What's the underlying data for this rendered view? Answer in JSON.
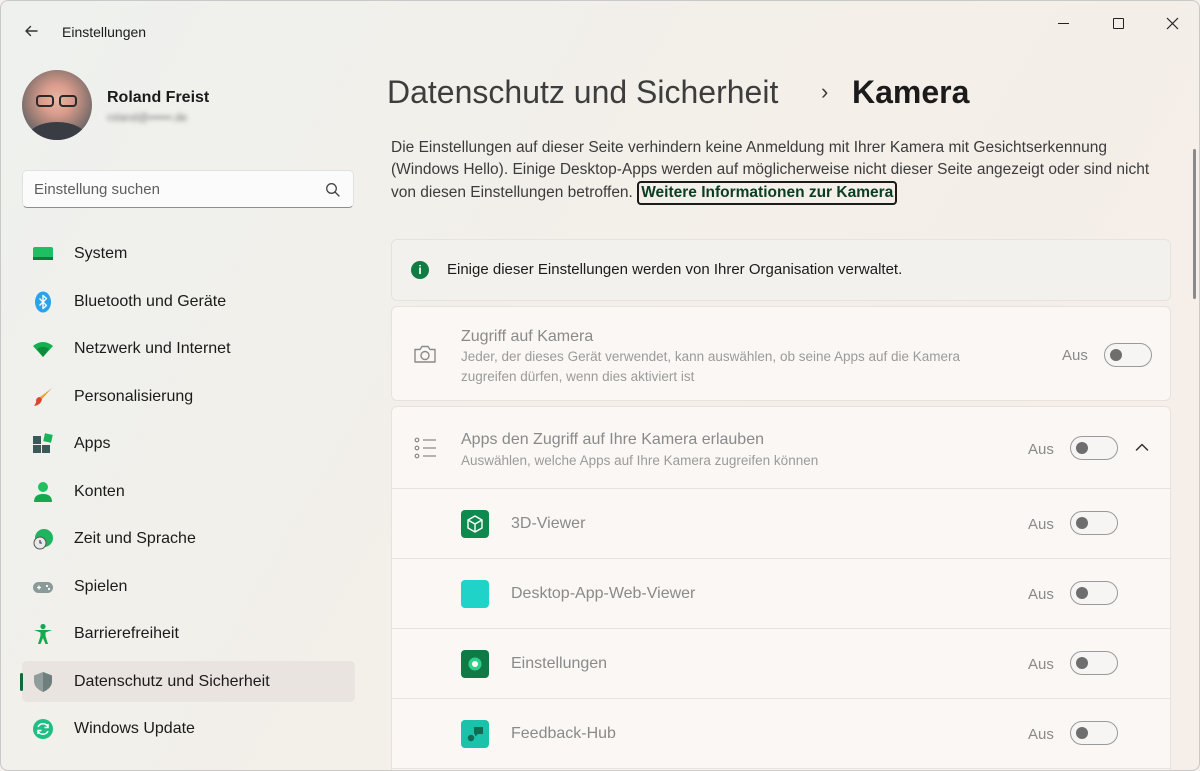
{
  "window": {
    "app_title": "Einstellungen",
    "back_icon": "back-arrow-icon",
    "controls": [
      "minimize",
      "maximize",
      "close"
    ]
  },
  "profile": {
    "name": "Roland Freist",
    "email": "roland@••••••.de"
  },
  "search": {
    "placeholder": "Einstellung suchen",
    "value": ""
  },
  "sidebar": {
    "items": [
      {
        "label": "System",
        "icon": "system-monitor-icon",
        "active": false
      },
      {
        "label": "Bluetooth und Geräte",
        "icon": "bluetooth-icon",
        "active": false
      },
      {
        "label": "Netzwerk und Internet",
        "icon": "wifi-icon",
        "active": false
      },
      {
        "label": "Personalisierung",
        "icon": "brush-icon",
        "active": false
      },
      {
        "label": "Apps",
        "icon": "apps-icon",
        "active": false
      },
      {
        "label": "Konten",
        "icon": "person-icon",
        "active": false
      },
      {
        "label": "Zeit und Sprache",
        "icon": "clock-globe-icon",
        "active": false
      },
      {
        "label": "Spielen",
        "icon": "gamepad-icon",
        "active": false
      },
      {
        "label": "Barrierefreiheit",
        "icon": "accessibility-icon",
        "active": false
      },
      {
        "label": "Datenschutz und Sicherheit",
        "icon": "shield-icon",
        "active": true
      },
      {
        "label": "Windows Update",
        "icon": "update-icon",
        "active": false
      }
    ]
  },
  "main": {
    "breadcrumb_parent": "Datenschutz und Sicherheit",
    "breadcrumb_sep": "›",
    "breadcrumb_current": "Kamera",
    "description": "Die Einstellungen auf dieser Seite verhindern keine Anmeldung mit Ihrer Kamera mit Gesichtserkennung (Windows Hello). Einige Desktop-Apps werden auf möglicherweise nicht dieser Seite angezeigt oder sind nicht von diesen Einstellungen betroffen.",
    "info_link": "Weitere Informationen zur Kamera",
    "notice": "Einige dieser Einstellungen werden von Ihrer Organisation verwaltet.",
    "camera_access": {
      "title": "Zugriff auf Kamera",
      "subtitle": "Jeder, der dieses Gerät verwendet, kann auswählen, ob seine Apps auf die Kamera zugreifen dürfen, wenn dies aktiviert ist",
      "state": "Aus",
      "on": false
    },
    "apps_access": {
      "title": "Apps den Zugriff auf Ihre Kamera erlauben",
      "subtitle": "Auswählen, welche Apps auf Ihre Kamera zugreifen können",
      "state": "Aus",
      "on": false,
      "expanded": true
    },
    "apps": [
      {
        "name": "3D-Viewer",
        "state": "Aus",
        "on": false,
        "icon": "3d-viewer-icon",
        "color": "#0f8a4f"
      },
      {
        "name": "Desktop-App-Web-Viewer",
        "state": "Aus",
        "on": false,
        "icon": "web-viewer-icon",
        "color": "#1fd3c8"
      },
      {
        "name": "Einstellungen",
        "state": "Aus",
        "on": false,
        "icon": "settings-gear-icon",
        "color": "#0f7a46"
      },
      {
        "name": "Feedback-Hub",
        "state": "Aus",
        "on": false,
        "icon": "feedback-hub-icon",
        "color": "#19c2a8"
      }
    ]
  },
  "colors": {
    "accent": "#0f6b3a",
    "info": "#107c41"
  }
}
